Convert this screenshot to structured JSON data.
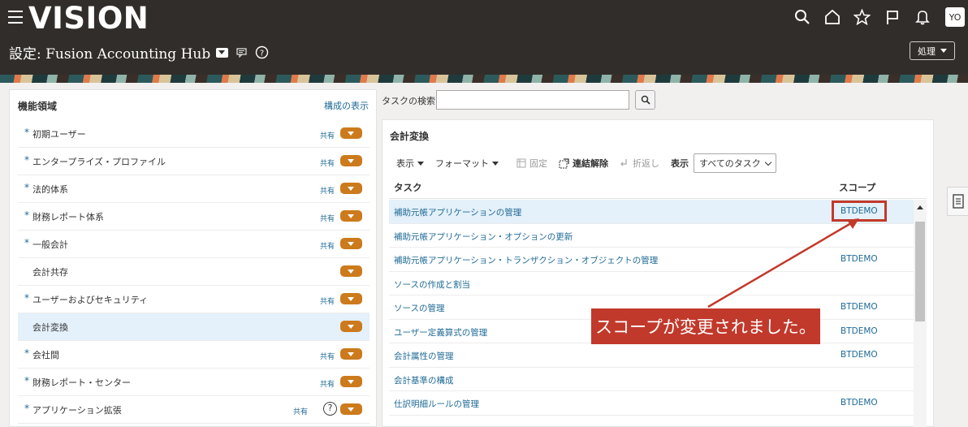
{
  "header": {
    "logo": "VISION",
    "page_title": "設定: Fusion Accounting Hub",
    "avatar": "YO",
    "action_label": "処理"
  },
  "left_panel": {
    "title": "機能領域",
    "link": "構成の表示",
    "items": [
      {
        "label": "初期ユーザー",
        "required": true,
        "shared": "共有"
      },
      {
        "label": "エンタープライズ・プロファイル",
        "required": true,
        "shared": "共有"
      },
      {
        "label": "法的体系",
        "required": true,
        "shared": "共有"
      },
      {
        "label": "財務レポート体系",
        "required": true,
        "shared": "共有"
      },
      {
        "label": "一般会計",
        "required": true,
        "shared": "共有"
      },
      {
        "label": "会計共存",
        "required": false,
        "shared": ""
      },
      {
        "label": "ユーザーおよびセキュリティ",
        "required": true,
        "shared": "共有"
      },
      {
        "label": "会計変換",
        "required": false,
        "shared": "",
        "selected": true
      },
      {
        "label": "会社間",
        "required": true,
        "shared": "共有"
      },
      {
        "label": "財務レポート・センター",
        "required": true,
        "shared": "共有"
      },
      {
        "label": "アプリケーション拡張",
        "required": true,
        "shared": "共有",
        "help": "?"
      }
    ],
    "required_marker": "*"
  },
  "search": {
    "label": "タスクの検索",
    "value": ""
  },
  "right_panel": {
    "title": "会計変換",
    "toolbar": {
      "view": "表示",
      "format": "フォーマット",
      "freeze": "固定",
      "detach": "連結解除",
      "wrap": "折返し",
      "show_label": "表示",
      "show_value": "すべてのタスク"
    },
    "columns": {
      "task": "タスク",
      "scope": "スコープ"
    },
    "rows": [
      {
        "task": "補助元帳アプリケーションの管理",
        "scope": "BTDEMO",
        "selected": true
      },
      {
        "task": "補助元帳アプリケーション・オプションの更新",
        "scope": ""
      },
      {
        "task": "補助元帳アプリケーション・トランザクション・オブジェクトの管理",
        "scope": "BTDEMO"
      },
      {
        "task": "ソースの作成と割当",
        "scope": ""
      },
      {
        "task": "ソースの管理",
        "scope": "BTDEMO"
      },
      {
        "task": "ユーザー定義算式の管理",
        "scope": "BTDEMO"
      },
      {
        "task": "会計属性の管理",
        "scope": "BTDEMO"
      },
      {
        "task": "会計基準の構成",
        "scope": ""
      },
      {
        "task": "仕訳明細ルールの管理",
        "scope": "BTDEMO"
      }
    ]
  },
  "annotation": {
    "callout": "スコープが変更されました。",
    "color": "#c1392b"
  },
  "icons": [
    "menu-icon",
    "search-icon",
    "home-icon",
    "star-icon",
    "flag-icon",
    "bell-icon",
    "help-icon",
    "panel-icon"
  ]
}
